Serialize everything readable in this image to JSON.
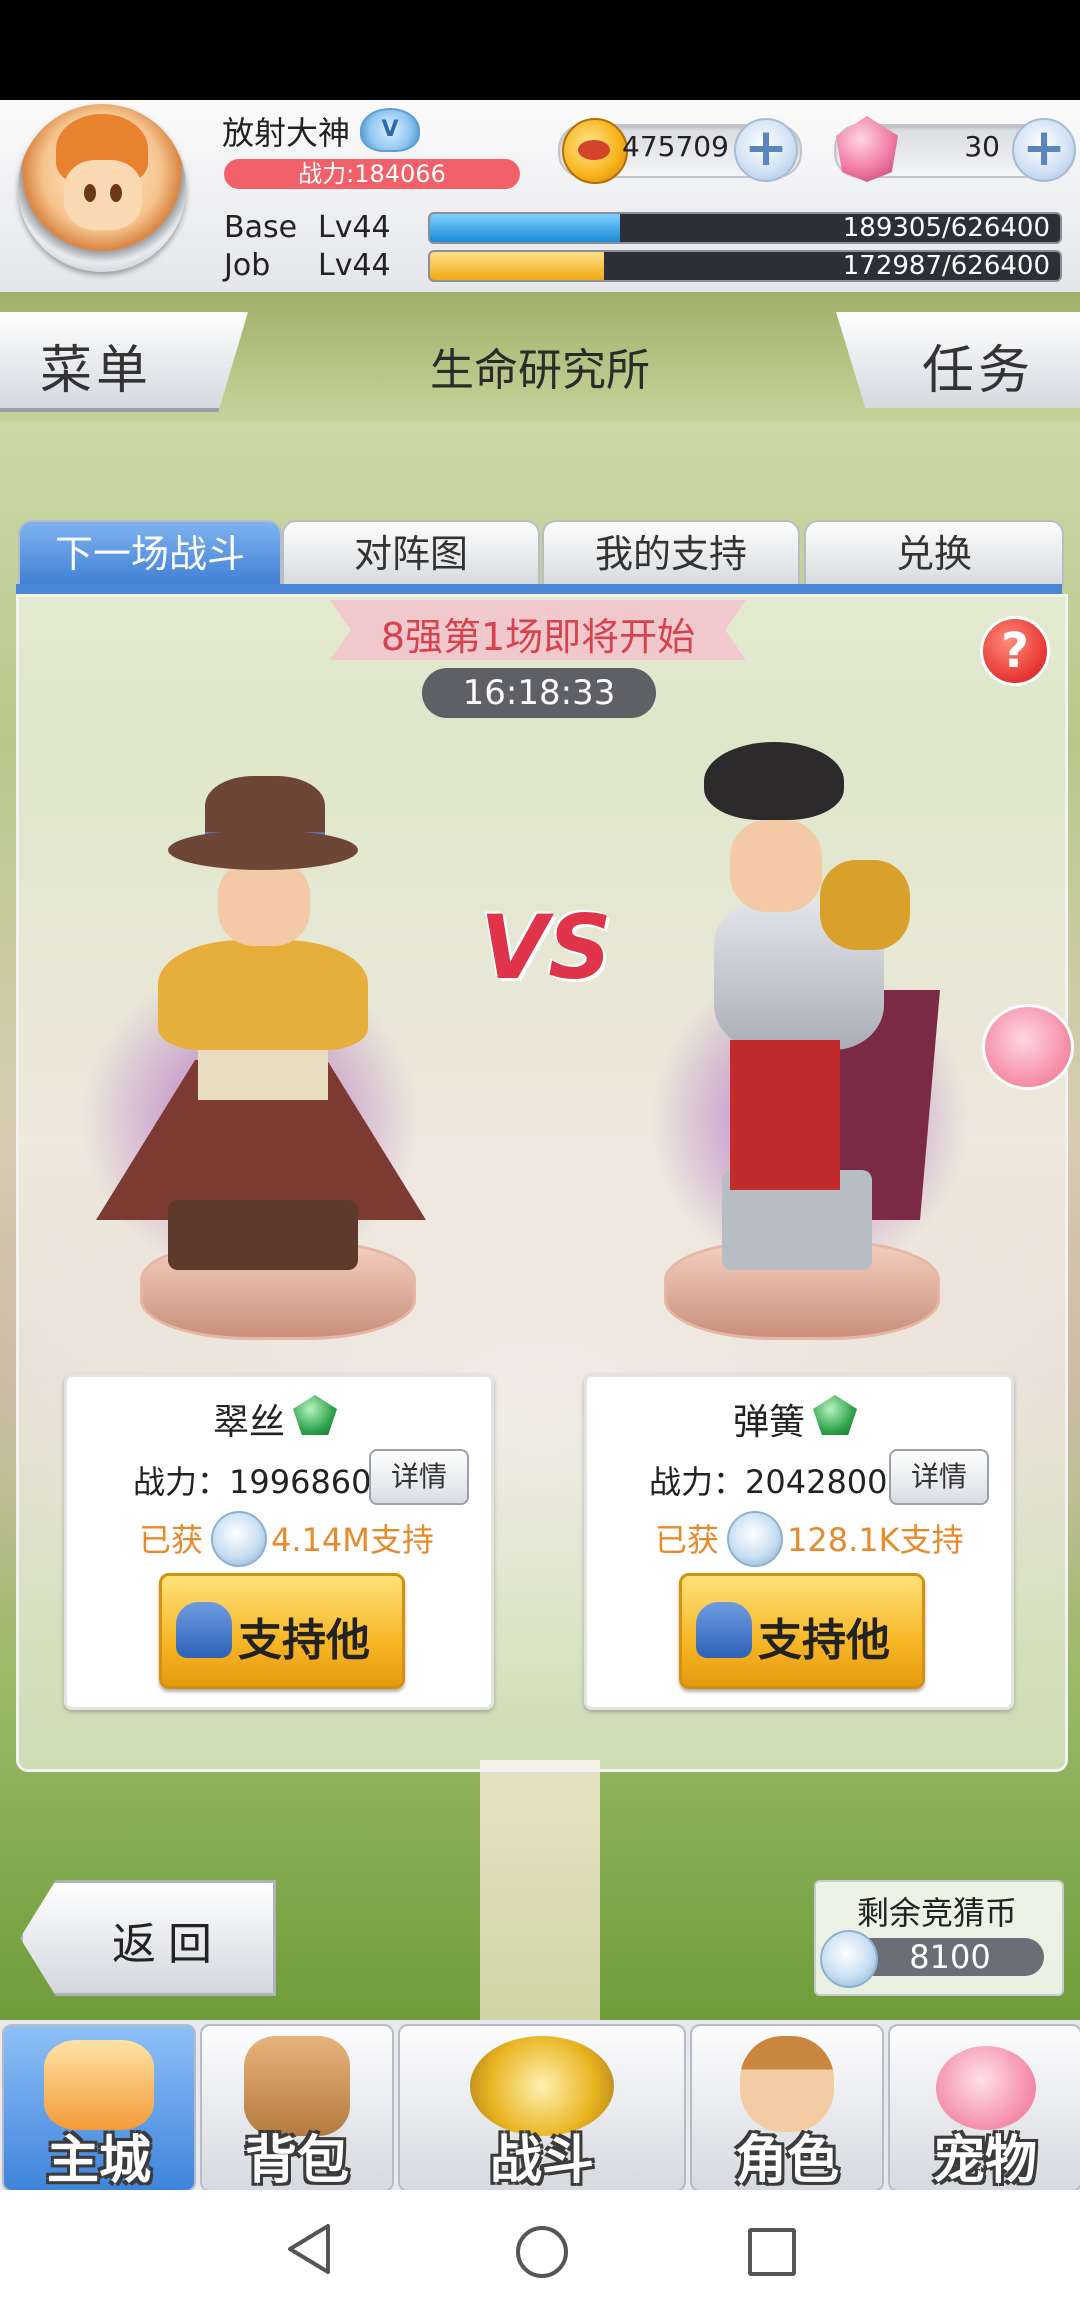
{
  "player": {
    "name": "放射大神",
    "power_label": "战力:184066",
    "gold": "475709",
    "gems": "30",
    "base_label": "Base",
    "base_level": "Lv44",
    "base_exp": "189305/626400",
    "base_exp_fraction": 0.302,
    "job_label": "Job",
    "job_level": "Lv44",
    "job_exp": "172987/626400",
    "job_exp_fraction": 0.276
  },
  "titlebar": {
    "menu_label": "菜单",
    "title": "生命研究所",
    "task_label": "任务"
  },
  "tabs": [
    {
      "label": "下一场战斗",
      "active": true
    },
    {
      "label": "对阵图",
      "active": false
    },
    {
      "label": "我的支持",
      "active": false
    },
    {
      "label": "兑换",
      "active": false
    }
  ],
  "match": {
    "banner": "8强第1场即将开始",
    "timer": "16:18:33",
    "vs": "VS",
    "help": "?"
  },
  "contestants": [
    {
      "name": "翠丝",
      "power": "战力：1996860",
      "detail_label": "详情",
      "got_prefix": "已获",
      "support_amount": "4.14M支持",
      "support_button": "支持他"
    },
    {
      "name": "弹簧",
      "power": "战力：2042800",
      "detail_label": "详情",
      "got_prefix": "已获",
      "support_amount": "128.1K支持",
      "support_button": "支持他"
    }
  ],
  "footer": {
    "back_label": "返回",
    "coins_title": "剩余竞猜币",
    "coins_value": "8100"
  },
  "bottom_nav": [
    {
      "label": "主城",
      "icon": "castle-icon",
      "active": true
    },
    {
      "label": "背包",
      "icon": "backpack-icon",
      "active": false
    },
    {
      "label": "战斗",
      "icon": "crossed-swords-icon",
      "active": false
    },
    {
      "label": "角色",
      "icon": "character-icon",
      "active": false
    },
    {
      "label": "宠物",
      "icon": "pet-icon",
      "active": false
    }
  ],
  "colors": {
    "tab_active": "#3f7fd3",
    "power_pill": "#f2616a",
    "base_bar": "#2fa5e8",
    "job_bar": "#f5b82a",
    "banner_text": "#d8424d",
    "support_text": "#e88a2c"
  }
}
